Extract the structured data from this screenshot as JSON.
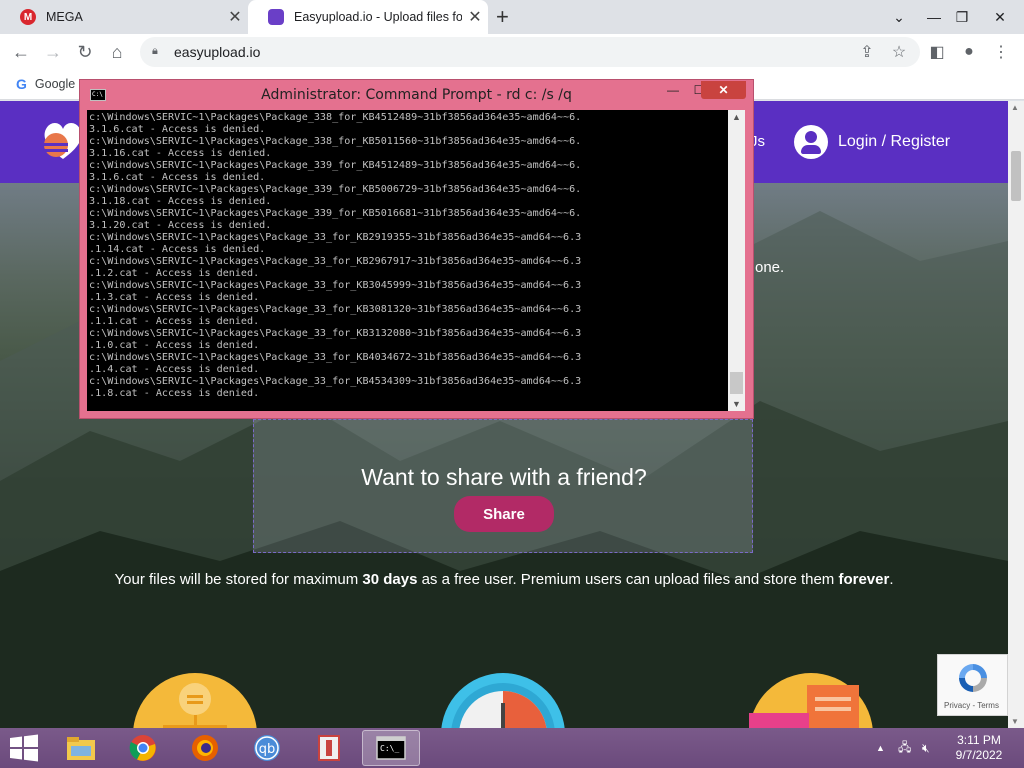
{
  "browser": {
    "tabs": [
      {
        "title": "MEGA",
        "favicon": "mega-icon",
        "active": false
      },
      {
        "title": "Easyupload.io - Upload files for f",
        "favicon": "easyupload-icon",
        "active": true
      }
    ],
    "new_tab_glyph": "+",
    "url": "easyupload.io",
    "bookmarks": [
      {
        "label": "Google"
      }
    ]
  },
  "page": {
    "nav_fragment": "Js",
    "login_label": "Login / Register",
    "intro_fragment": "one.",
    "share_title": "Want to share with a friend?",
    "share_button": "Share",
    "storage_prefix": "Your files will be stored for maximum ",
    "storage_days": "30 days",
    "storage_middle": " as a free user. Premium users can upload files and store them ",
    "storage_forever": "forever",
    "storage_suffix": ".",
    "recaptcha_links": "Privacy - Terms",
    "colors": {
      "header": "#5a2fc2",
      "share_button": "#b22a66"
    }
  },
  "cmd": {
    "title": "Administrator: Command Prompt - rd  c: /s /q",
    "lines": [
      "c:\\Windows\\SERVIC~1\\Packages\\Package_338_for_KB4512489~31bf3856ad364e35~amd64~~6.",
      "3.1.6.cat - Access is denied.",
      "c:\\Windows\\SERVIC~1\\Packages\\Package_338_for_KB5011560~31bf3856ad364e35~amd64~~6.",
      "3.1.16.cat - Access is denied.",
      "c:\\Windows\\SERVIC~1\\Packages\\Package_339_for_KB4512489~31bf3856ad364e35~amd64~~6.",
      "3.1.6.cat - Access is denied.",
      "c:\\Windows\\SERVIC~1\\Packages\\Package_339_for_KB5006729~31bf3856ad364e35~amd64~~6.",
      "3.1.18.cat - Access is denied.",
      "c:\\Windows\\SERVIC~1\\Packages\\Package_339_for_KB5016681~31bf3856ad364e35~amd64~~6.",
      "3.1.20.cat - Access is denied.",
      "c:\\Windows\\SERVIC~1\\Packages\\Package_33_for_KB2919355~31bf3856ad364e35~amd64~~6.3",
      ".1.14.cat - Access is denied.",
      "c:\\Windows\\SERVIC~1\\Packages\\Package_33_for_KB2967917~31bf3856ad364e35~amd64~~6.3",
      ".1.2.cat - Access is denied.",
      "c:\\Windows\\SERVIC~1\\Packages\\Package_33_for_KB3045999~31bf3856ad364e35~amd64~~6.3",
      ".1.3.cat - Access is denied.",
      "c:\\Windows\\SERVIC~1\\Packages\\Package_33_for_KB3081320~31bf3856ad364e35~amd64~~6.3",
      ".1.1.cat - Access is denied.",
      "c:\\Windows\\SERVIC~1\\Packages\\Package_33_for_KB3132080~31bf3856ad364e35~amd64~~6.3",
      ".1.0.cat - Access is denied.",
      "c:\\Windows\\SERVIC~1\\Packages\\Package_33_for_KB4034672~31bf3856ad364e35~amd64~~6.3",
      ".1.4.cat - Access is denied.",
      "c:\\Windows\\SERVIC~1\\Packages\\Package_33_for_KB4534309~31bf3856ad364e35~amd64~~6.3",
      ".1.8.cat - Access is denied."
    ],
    "colors": {
      "frame": "#e4718f",
      "close": "#c9433f"
    }
  },
  "taskbar": {
    "apps": [
      {
        "name": "file-explorer-icon"
      },
      {
        "name": "chrome-icon"
      },
      {
        "name": "firefox-icon"
      },
      {
        "name": "qbittorrent-icon"
      },
      {
        "name": "pdf-app-icon"
      },
      {
        "name": "command-prompt-icon",
        "active": true
      }
    ],
    "time": "3:11 PM",
    "date": "9/7/2022"
  }
}
